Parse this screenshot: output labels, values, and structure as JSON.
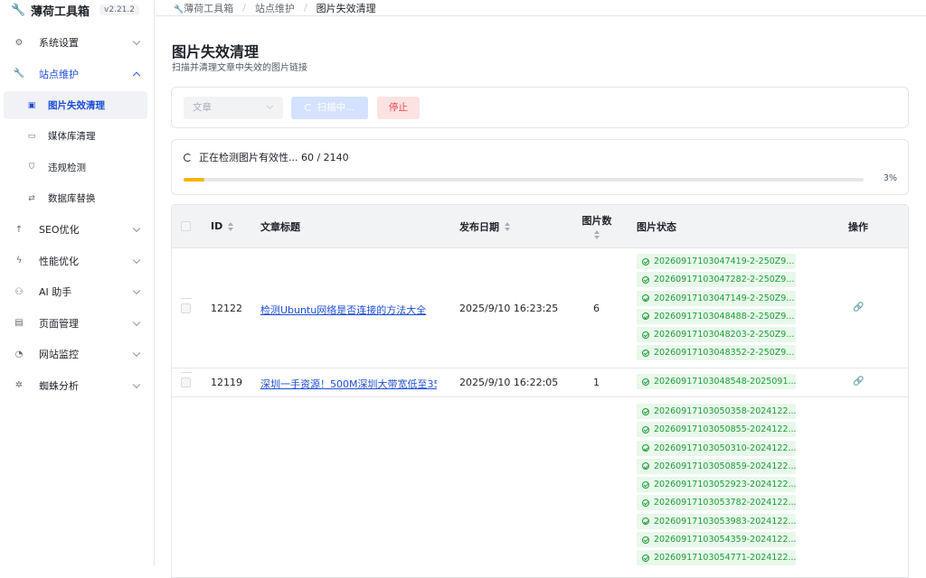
{
  "brand": {
    "name": "薄荷工具箱",
    "version": "v2.21.2"
  },
  "sidebar": {
    "items": [
      {
        "label": "系统设置",
        "icon": "gear-icon",
        "glyph": "⚙",
        "expanded": false
      },
      {
        "label": "站点维护",
        "icon": "wrench-icon",
        "glyph": "🔧",
        "expanded": true,
        "active": true
      },
      {
        "label": "SEO优化",
        "icon": "arrow-up-icon",
        "glyph": "↑",
        "expanded": false
      },
      {
        "label": "性能优化",
        "icon": "bolt-icon",
        "glyph": "ϟ",
        "expanded": false
      },
      {
        "label": "AI 助手",
        "icon": "robot-icon",
        "glyph": "⚇",
        "expanded": false
      },
      {
        "label": "页面管理",
        "icon": "page-icon",
        "glyph": "▤",
        "expanded": false
      },
      {
        "label": "网站监控",
        "icon": "gauge-icon",
        "glyph": "◔",
        "expanded": false
      },
      {
        "label": "蜘蛛分析",
        "icon": "bug-icon",
        "glyph": "✲",
        "expanded": false
      }
    ],
    "subitems": [
      {
        "label": "图片失效清理",
        "icon": "image-icon",
        "glyph": "▣",
        "selected": true
      },
      {
        "label": "媒体库清理",
        "icon": "folder-icon",
        "glyph": "▭",
        "selected": false
      },
      {
        "label": "违规检测",
        "icon": "shield-icon",
        "glyph": "⛉",
        "selected": false
      },
      {
        "label": "数据库替换",
        "icon": "swap-icon",
        "glyph": "⇄",
        "selected": false
      }
    ]
  },
  "breadcrumb": {
    "items": [
      "薄荷工具箱",
      "站点维护",
      "图片失效清理"
    ]
  },
  "page": {
    "title": "图片失效清理",
    "subtitle": "扫描并清理文章中失效的图片链接"
  },
  "toolbar": {
    "type_value": "文章",
    "scan_label": "扫描中...",
    "stop_label": "停止"
  },
  "progress": {
    "text": "正在检测图片有效性... 60 / 2140",
    "percent_label": "3%",
    "fraction": 0.03
  },
  "table": {
    "headers": {
      "id": "ID",
      "title": "文章标题",
      "date": "发布日期",
      "count": "图片数",
      "status": "图片状态",
      "action": "操作"
    },
    "rows": [
      {
        "id": "12122",
        "title": "检测Ubuntu网络是否连接的方法大全",
        "date": "2025/9/10 16:23:25",
        "count": "6",
        "images": [
          "20260917103047419-2-250Z9...",
          "20260917103047282-2-250Z9...",
          "20260917103047149-2-250Z9...",
          "20260917103048488-2-250Z9...",
          "20260917103048203-2-250Z9...",
          "20260917103048352-2-250Z9..."
        ]
      },
      {
        "id": "12119",
        "title": "深圳一手资源！500M深圳大带宽低至35",
        "date": "2025/9/10 16:22:05",
        "count": "1",
        "images": [
          "20260917103048548-2025091..."
        ]
      },
      {
        "id": "",
        "title": "",
        "date": "",
        "count": "",
        "images": [
          "20260917103050358-2024122...",
          "20260917103050855-2024122...",
          "20260917103050310-2024122...",
          "20260917103050859-2024122...",
          "20260917103052923-2024122...",
          "20260917103053782-2024122...",
          "20260917103053983-2024122...",
          "20260917103054359-2024122...",
          "20260917103054771-2024122..."
        ]
      }
    ]
  }
}
